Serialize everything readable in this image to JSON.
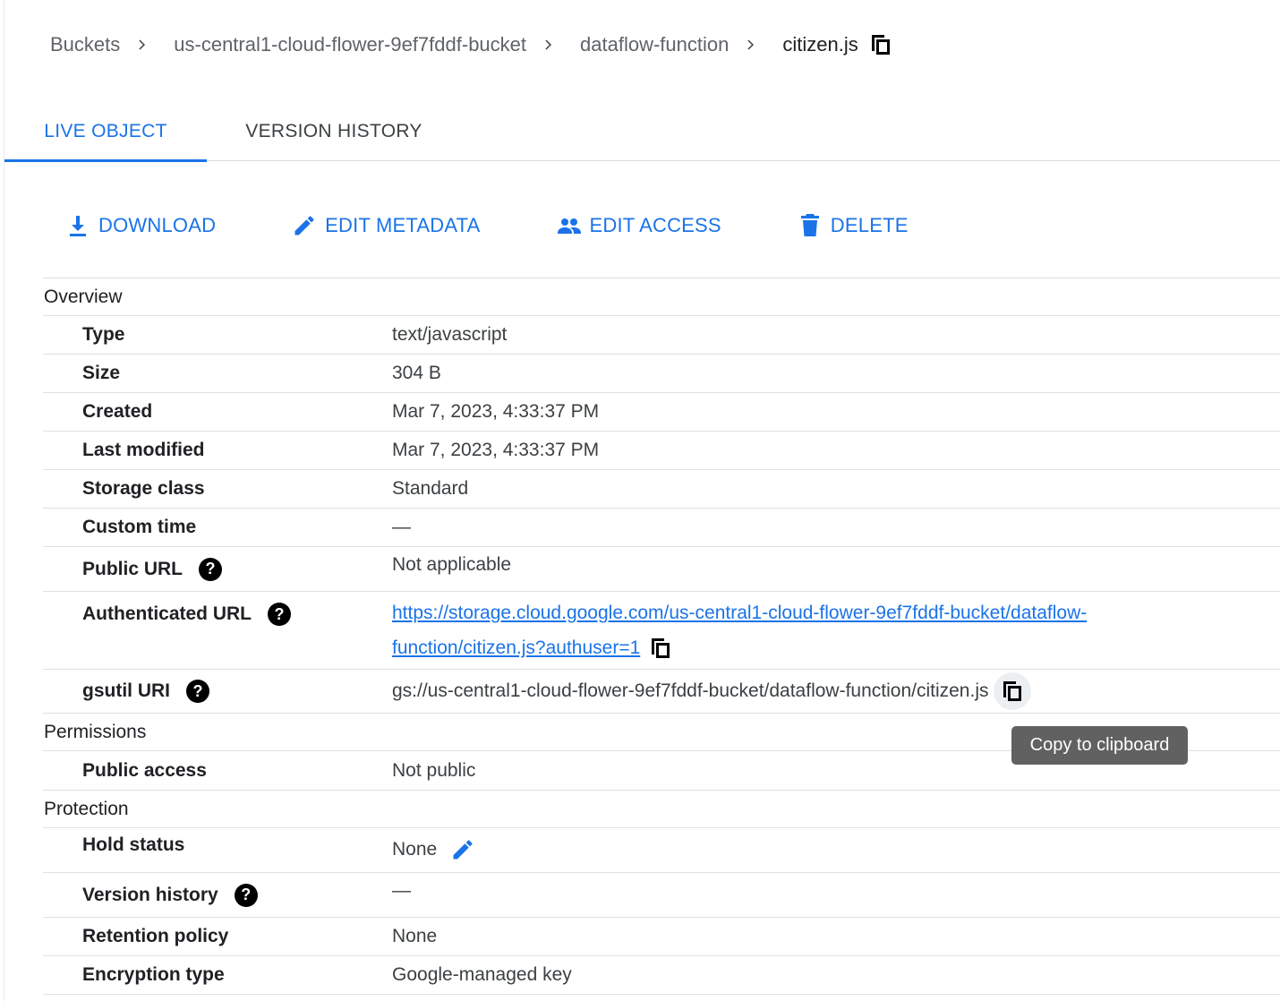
{
  "breadcrumb": {
    "items": [
      "Buckets",
      "us-central1-cloud-flower-9ef7fddf-bucket",
      "dataflow-function"
    ],
    "current": "citizen.js"
  },
  "tabs": [
    {
      "label": "LIVE OBJECT",
      "active": true
    },
    {
      "label": "VERSION HISTORY",
      "active": false
    }
  ],
  "actions": {
    "download": "DOWNLOAD",
    "edit_metadata": "EDIT METADATA",
    "edit_access": "EDIT ACCESS",
    "delete": "DELETE"
  },
  "overview": {
    "title": "Overview",
    "type": {
      "label": "Type",
      "value": "text/javascript"
    },
    "size": {
      "label": "Size",
      "value": "304 B"
    },
    "created": {
      "label": "Created",
      "value": "Mar 7, 2023, 4:33:37 PM"
    },
    "last_modified": {
      "label": "Last modified",
      "value": "Mar 7, 2023, 4:33:37 PM"
    },
    "storage_class": {
      "label": "Storage class",
      "value": "Standard"
    },
    "custom_time": {
      "label": "Custom time",
      "value": "—"
    },
    "public_url": {
      "label": "Public URL",
      "value": "Not applicable"
    },
    "authenticated_url": {
      "label": "Authenticated URL",
      "line1": "https://storage.cloud.google.com/us-central1-cloud-flower-9ef7fddf-bucket/dataflow-",
      "line2": "function/citizen.js?authuser=1"
    },
    "gsutil_uri": {
      "label": "gsutil URI",
      "value": "gs://us-central1-cloud-flower-9ef7fddf-bucket/dataflow-function/citizen.js"
    }
  },
  "permissions": {
    "title": "Permissions",
    "public_access": {
      "label": "Public access",
      "value": "Not public"
    }
  },
  "protection": {
    "title": "Protection",
    "hold_status": {
      "label": "Hold status",
      "value": "None"
    },
    "version_history": {
      "label": "Version history",
      "value": "—"
    },
    "retention_policy": {
      "label": "Retention policy",
      "value": "None"
    },
    "encryption_type": {
      "label": "Encryption type",
      "value": "Google-managed key"
    }
  },
  "help_glyph": "?",
  "tooltip": "Copy to clipboard",
  "colors": {
    "accent": "#1a73e8",
    "text": "#202124",
    "muted": "#5f6368",
    "tooltip_bg": "#616161"
  },
  "icons": [
    "chevron-right-icon",
    "copy-icon",
    "download-icon",
    "pencil-icon",
    "people-icon",
    "trash-icon",
    "help-icon"
  ]
}
